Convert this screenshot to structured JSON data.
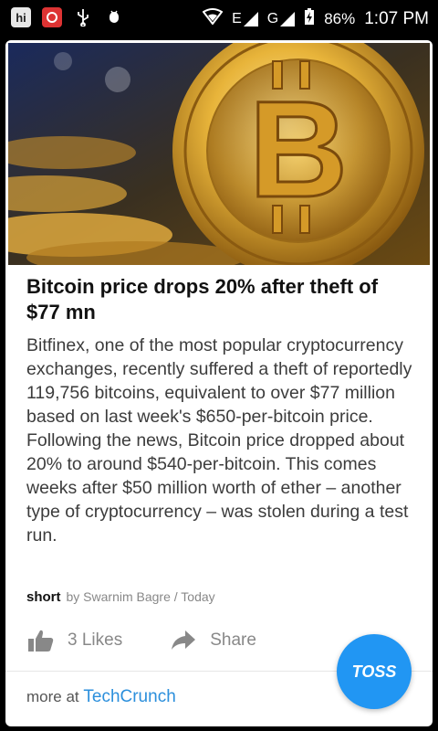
{
  "status_bar": {
    "app_badge": "hi",
    "network_e": "E",
    "network_g": "G",
    "battery": "86%",
    "time": "1:07 PM"
  },
  "article": {
    "image_alt": "Gold bitcoin coin",
    "headline": "Bitcoin price drops 20% after theft of $77 mn",
    "body": "Bitfinex, one of the most popular cryptocurrency exchanges, recently suffered a theft of reportedly 119,756 bitcoins, equivalent to over $77 million based on last week's $650-per-bitcoin price. Following the news, Bitcoin price dropped about 20% to around $540-per-bitcoin. This comes weeks after $50 million worth of ether – another type of cryptocurrency – was stolen during a test run.",
    "brand": "short",
    "byline": "by Swarnim Bagre / Today"
  },
  "actions": {
    "likes": "3 Likes",
    "share": "Share",
    "toss": "TOSS"
  },
  "source": {
    "prefix": "more at",
    "name": "TechCrunch"
  }
}
